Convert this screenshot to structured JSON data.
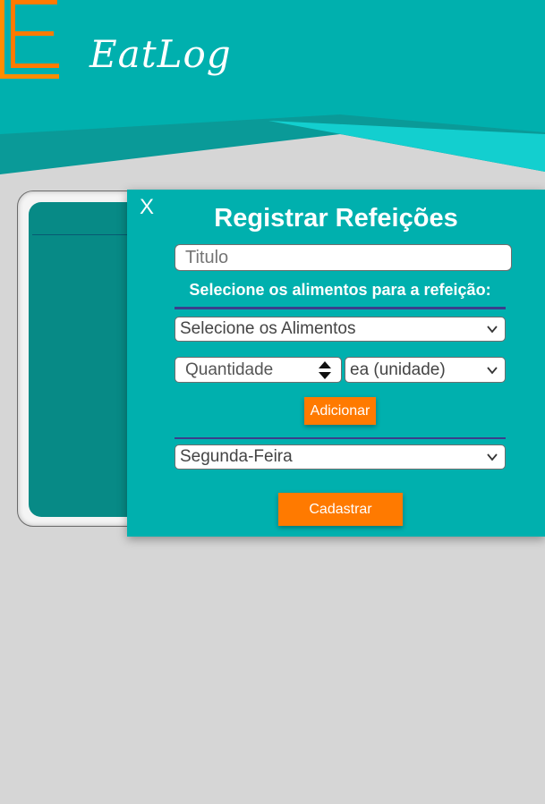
{
  "header": {
    "brand_name": "EatLog",
    "colors": {
      "teal": "#00b0ae",
      "teal_light": "#13cfcf",
      "orange": "#ff7a00"
    }
  },
  "modal": {
    "close_label": "X",
    "title": "Registrar Refeições",
    "titulo_placeholder": "Titulo",
    "foods_prompt": "Selecione os alimentos para a refeição:",
    "foods_select_value": "Selecione os Alimentos",
    "quantity_placeholder": "Quantidade",
    "unit_select_value": "ea (unidade)",
    "add_button_label": "Adicionar",
    "day_select_value": "Segunda-Feira",
    "submit_button_label": "Cadastrar"
  }
}
